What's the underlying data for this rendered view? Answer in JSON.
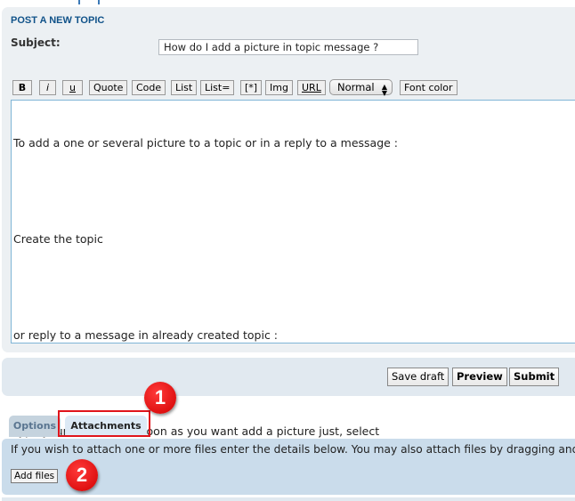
{
  "form": {
    "title": "POST A NEW TOPIC",
    "subject_label": "Subject:",
    "subject_value": "How do I add a picture in topic message ?"
  },
  "toolbar": {
    "buttons": [
      "B",
      "i",
      "u",
      "Quote",
      "Code",
      "List",
      "List=",
      "[*]",
      "Img",
      "URL"
    ],
    "font_size_select": "Normal",
    "font_color": "Font color"
  },
  "message": {
    "lines": [
      "To add a one or several picture to a topic or in a reply to a message :",
      "",
      "Create the topic",
      "",
      "or reply to a message in already created topic :",
      "",
      "Type your text, and as soon as you want add a picture just, select"
    ]
  },
  "actions": {
    "save_draft": "Save draft",
    "preview": "Preview",
    "submit": "Submit"
  },
  "tabs": [
    {
      "label": "Options",
      "active": false
    },
    {
      "label": "Attachments",
      "active": true
    }
  ],
  "attachments": {
    "description": "If you wish to attach one or more files enter the details below. You may also attach files by dragging and",
    "add_files": "Add files"
  },
  "annotations": {
    "step1": "1",
    "step2": "2"
  },
  "colors": {
    "title": "#105289",
    "annotation": "#e0141b",
    "panel": "#ecf0f3",
    "attach_panel": "#cadceb"
  }
}
